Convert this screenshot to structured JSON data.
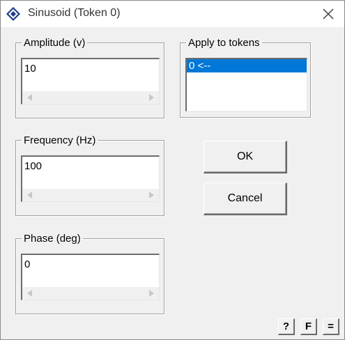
{
  "window": {
    "title": "Sinusoid (Token 0)",
    "app_icon": "diamond-app-icon",
    "close_icon": "close-x-icon"
  },
  "fields": {
    "amplitude": {
      "label": "Amplitude (v)",
      "value": "10"
    },
    "frequency": {
      "label": "Frequency (Hz)",
      "value": "100"
    },
    "phase": {
      "label": "Phase (deg)",
      "value": "0"
    }
  },
  "apply_tokens": {
    "label": "Apply to tokens",
    "items": [
      "0 <--"
    ],
    "selected_index": 0
  },
  "buttons": {
    "ok": "OK",
    "cancel": "Cancel",
    "help": "?",
    "f": "F",
    "equals": "="
  },
  "colors": {
    "selection": "#0078d7",
    "face": "#f0f0f0",
    "title_bg": "#ffffff"
  }
}
